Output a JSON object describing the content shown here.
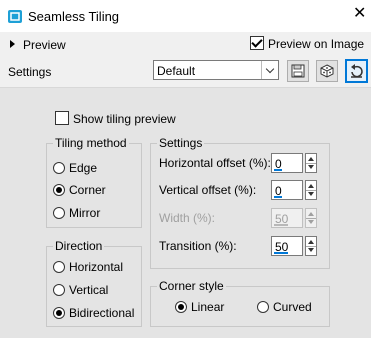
{
  "window": {
    "title": "Seamless Tiling",
    "close_symbol": "✕"
  },
  "header": {
    "preview_label": "Preview",
    "preview_on_image_label": "Preview on Image",
    "preview_on_image_checked": true
  },
  "settings_row": {
    "label": "Settings",
    "preset_value": "Default"
  },
  "show_tiling_preview": {
    "label": "Show tiling preview",
    "checked": false
  },
  "tiling_method": {
    "title": "Tiling method",
    "options": [
      {
        "label": "Edge",
        "selected": false
      },
      {
        "label": "Corner",
        "selected": true
      },
      {
        "label": "Mirror",
        "selected": false
      }
    ]
  },
  "settings_group": {
    "title": "Settings",
    "fields": [
      {
        "label": "Horizontal offset (%):",
        "value": "0",
        "enabled": true,
        "fill": 0
      },
      {
        "label": "Vertical offset (%):",
        "value": "0",
        "enabled": true,
        "fill": 0
      },
      {
        "label": "Width (%):",
        "value": "50",
        "enabled": false,
        "fill": 0.5
      },
      {
        "label": "Transition (%):",
        "value": "50",
        "enabled": true,
        "fill": 0.5
      }
    ]
  },
  "direction": {
    "title": "Direction",
    "options": [
      {
        "label": "Horizontal",
        "selected": false
      },
      {
        "label": "Vertical",
        "selected": false
      },
      {
        "label": "Bidirectional",
        "selected": true
      }
    ]
  },
  "corner_style": {
    "title": "Corner style",
    "options": [
      {
        "label": "Linear",
        "selected": true
      },
      {
        "label": "Curved",
        "selected": false
      }
    ]
  },
  "icons": {
    "app": "seamless-tiling-app-icon",
    "save_preset": "floppy-disk-icon",
    "randomize": "dice-icon",
    "reset": "reset-arrow-icon"
  },
  "colors": {
    "accent": "#0078d7",
    "panel": "#e4e4e4",
    "app_icon": "#1ea0d6"
  }
}
